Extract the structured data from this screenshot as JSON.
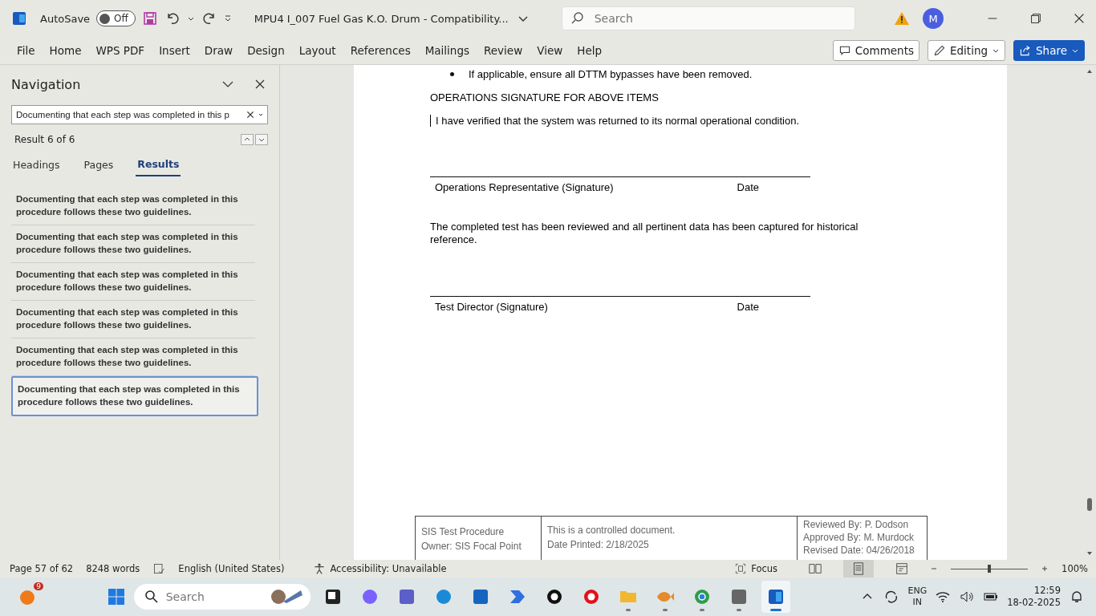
{
  "title_bar": {
    "autosave_label": "AutoSave",
    "autosave_on": false,
    "autosave_state": "Off",
    "document_title": "MPU4 I_007 Fuel Gas K.O. Drum  -  Compatibility...",
    "search_placeholder": "Search",
    "avatar_initial": "M"
  },
  "ribbon": {
    "tabs": [
      {
        "label": "File",
        "selected": false
      },
      {
        "label": "Home",
        "selected": false
      },
      {
        "label": "WPS PDF",
        "selected": false
      },
      {
        "label": "Insert",
        "selected": false
      },
      {
        "label": "Draw",
        "selected": false
      },
      {
        "label": "Design",
        "selected": false
      },
      {
        "label": "Layout",
        "selected": false
      },
      {
        "label": "References",
        "selected": false
      },
      {
        "label": "Mailings",
        "selected": false
      },
      {
        "label": "Review",
        "selected": false
      },
      {
        "label": "View",
        "selected": false
      },
      {
        "label": "Help",
        "selected": false
      }
    ],
    "comments_label": "Comments",
    "editing_label": "Editing",
    "share_label": "Share"
  },
  "navigation": {
    "title": "Navigation",
    "search_value": "Documenting that each step was completed in this p",
    "result_count": "Result 6 of 6",
    "tabs": [
      {
        "label": "Headings",
        "selected": false
      },
      {
        "label": "Pages",
        "selected": false
      },
      {
        "label": "Results",
        "selected": true
      }
    ],
    "results": [
      {
        "text": "Documenting that each step was completed in this procedure follows these two guidelines.",
        "selected": false
      },
      {
        "text": "Documenting that each step was completed in this procedure follows these two guidelines.",
        "selected": false
      },
      {
        "text": "Documenting that each step was completed in this procedure follows these two guidelines.",
        "selected": false
      },
      {
        "text": "Documenting that each step was completed in this procedure follows these two guidelines.",
        "selected": false
      },
      {
        "text": "Documenting that each step was completed in this procedure follows these two guidelines.",
        "selected": false
      },
      {
        "text": "Documenting that each step was completed in this procedure follows these two guidelines.",
        "selected": true
      }
    ]
  },
  "document": {
    "bullet": "If applicable, ensure all DTTM bypasses have been removed.",
    "heading": "OPERATIONS SIGNATURE FOR ABOVE ITEMS",
    "statement": "I have verified that the system was returned to its normal operational condition.",
    "signatures": [
      {
        "label": "Operations Representative (Signature)",
        "date_label": "Date",
        "note": "The completed test has been reviewed and all pertinent data has been captured for historical reference."
      },
      {
        "label": "Test Director (Signature)",
        "date_label": "Date"
      }
    ],
    "footer": {
      "column_1": [
        "SIS Test Procedure",
        "Owner: SIS Focal Point"
      ],
      "column_2": [
        "This is a controlled document.",
        "Date Printed: 2/18/2025"
      ],
      "column_3": [
        "Reviewed By: P. Dodson",
        "Approved By: M. Murdock",
        "Revised Date: 04/26/2018"
      ]
    }
  },
  "status_bar": {
    "page": "Page 57 of 62",
    "words": "8248 words",
    "language": "English (United States)",
    "accessibility": "Accessibility: Unavailable",
    "focus": "Focus",
    "zoom": "100%",
    "zoom_slider": {
      "level": 0.5
    }
  },
  "taskbar": {
    "notification_count": "9",
    "search_placeholder": "Search",
    "apps": [
      {
        "kind": "taskview",
        "open": false,
        "active": false
      },
      {
        "kind": "copilot",
        "open": false,
        "active": false
      },
      {
        "kind": "teams",
        "open": false,
        "active": false
      },
      {
        "kind": "edge",
        "open": false,
        "active": false
      },
      {
        "kind": "store",
        "open": false,
        "active": false
      },
      {
        "kind": "automate",
        "open": false,
        "active": false
      },
      {
        "kind": "dell",
        "open": false,
        "active": false
      },
      {
        "kind": "opera",
        "open": false,
        "active": false
      },
      {
        "kind": "folder",
        "open": true,
        "active": false
      },
      {
        "kind": "fish",
        "open": true,
        "active": false
      },
      {
        "kind": "chrome",
        "open": true,
        "active": false
      },
      {
        "kind": "contacts",
        "open": true,
        "active": false
      },
      {
        "kind": "word",
        "open": true,
        "active": true
      }
    ],
    "language": "ENG",
    "region": "IN",
    "time": "12:59",
    "date": "18-02-2025"
  }
}
